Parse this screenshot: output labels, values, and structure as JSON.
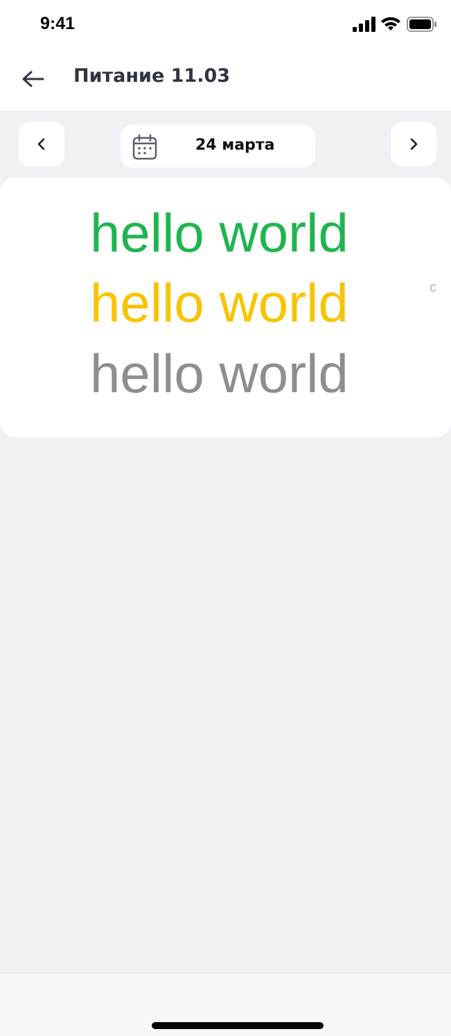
{
  "status_bar": {
    "time": "9:41"
  },
  "header": {
    "title": "Питание 11.03"
  },
  "date_nav": {
    "date_label": "24 марта"
  },
  "card": {
    "lines": [
      {
        "text": "hello world",
        "color": "#1fb54f"
      },
      {
        "text": "hello world",
        "color": "#f8c400"
      },
      {
        "text": "hello world",
        "color": "#8e8e90"
      }
    ],
    "edge_char": "с"
  },
  "icons": [
    "signal-icon",
    "wifi-icon",
    "battery-icon",
    "back-arrow-icon",
    "chevron-left-icon",
    "calendar-icon",
    "chevron-right-icon"
  ]
}
